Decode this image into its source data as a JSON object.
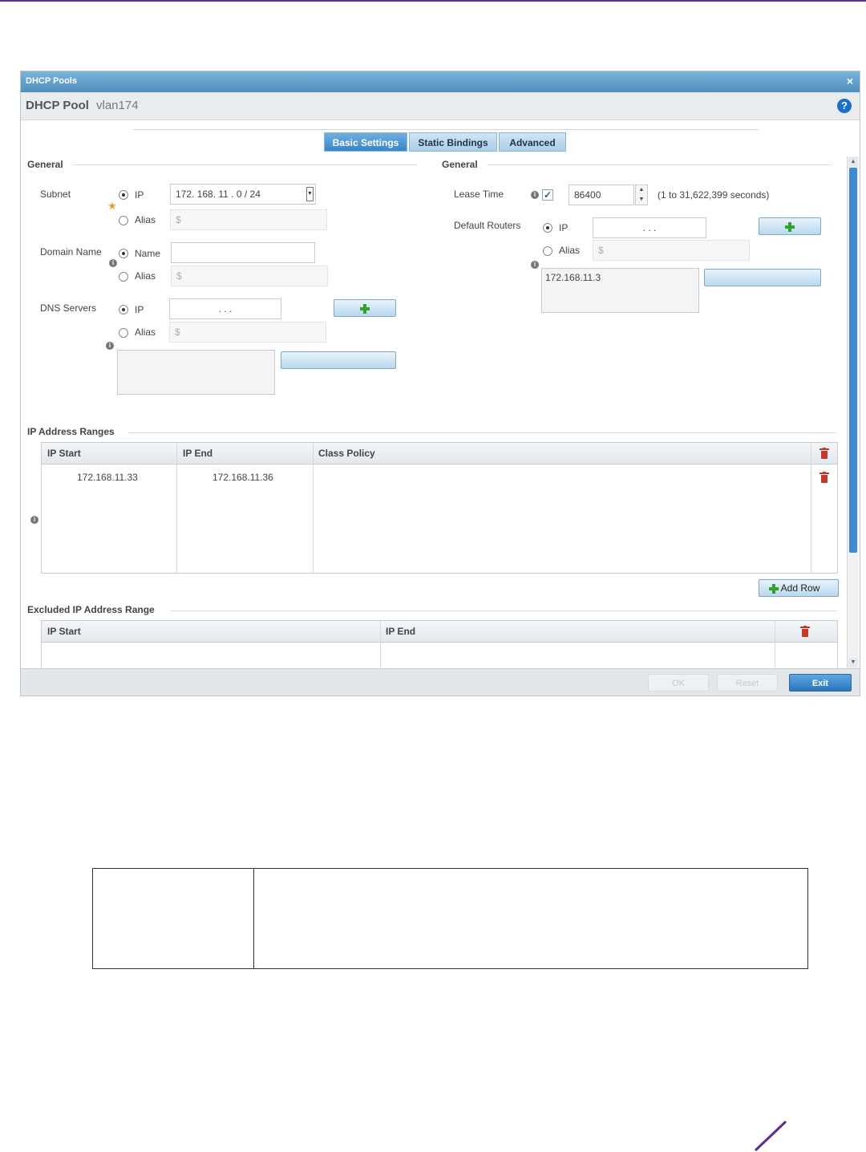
{
  "dialog": {
    "title": "DHCP Pools",
    "close_glyph": "×",
    "header_label": "DHCP Pool",
    "pool_name": "vlan174",
    "help_glyph": "?"
  },
  "tabs": [
    {
      "label": "Basic Settings",
      "active": true
    },
    {
      "label": "Static Bindings",
      "active": false
    },
    {
      "label": "Advanced",
      "active": false
    }
  ],
  "left_general": {
    "title": "General",
    "subnet": {
      "label": "Subnet",
      "ip_label": "IP",
      "ip_value": "172. 168. 11 .  0  /  24",
      "alias_label": "Alias",
      "alias_value": "$",
      "selected": "ip"
    },
    "domain_name": {
      "label": "Domain Name",
      "name_label": "Name",
      "name_value": "",
      "alias_label": "Alias",
      "alias_value": "$",
      "selected": "name"
    },
    "dns_servers": {
      "label": "DNS Servers",
      "ip_label": "IP",
      "ip_value": ".    .    .",
      "alias_label": "Alias",
      "alias_value": "$",
      "selected": "ip",
      "list": []
    }
  },
  "right_general": {
    "title": "General",
    "lease_time": {
      "label": "Lease Time",
      "checked": true,
      "value": "86400",
      "hint": "(1 to 31,622,399 seconds)"
    },
    "default_routers": {
      "label": "Default Routers",
      "ip_label": "IP",
      "ip_value": ".    .    .",
      "alias_label": "Alias",
      "alias_value": "$",
      "selected": "ip",
      "list": [
        "172.168.11.3"
      ]
    }
  },
  "ip_ranges": {
    "title": "IP Address Ranges",
    "columns": [
      "IP Start",
      "IP End",
      "Class Policy"
    ],
    "rows": [
      {
        "start": "172.168.11.33",
        "end": "172.168.11.36",
        "policy": ""
      }
    ],
    "add_row_label": "Add Row"
  },
  "excluded_ranges": {
    "title": "Excluded IP Address Range",
    "columns": [
      "IP Start",
      "IP End"
    ]
  },
  "footer": {
    "ok_label": "OK",
    "reset_label": "Reset",
    "exit_label": "Exit"
  },
  "colors": {
    "accent": "#3a86c8",
    "brand_purple": "#5b2d8e",
    "delete": "#c0392b",
    "add": "#2fa22a"
  }
}
